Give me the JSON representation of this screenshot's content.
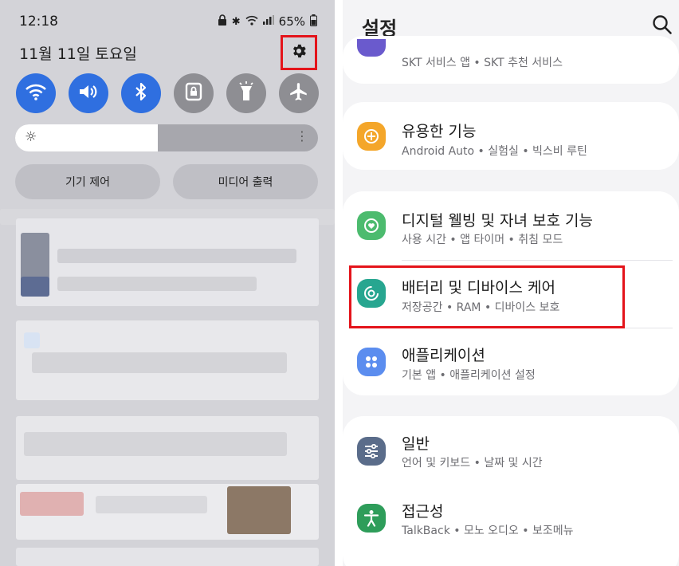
{
  "quick_panel": {
    "status": {
      "time": "12:18",
      "battery": "65%"
    },
    "date": "11월 11일 토요일",
    "settings_icon": "gear-icon",
    "tiles": [
      {
        "name": "wifi",
        "icon": "wifi-icon",
        "state": "on"
      },
      {
        "name": "sound",
        "icon": "volume-icon",
        "state": "on"
      },
      {
        "name": "bluetooth",
        "icon": "bluetooth-icon",
        "state": "on"
      },
      {
        "name": "lock-screen",
        "icon": "lock-icon",
        "state": "off"
      },
      {
        "name": "flashlight",
        "icon": "flashlight-icon",
        "state": "off"
      },
      {
        "name": "airplane",
        "icon": "airplane-icon",
        "state": "off"
      }
    ],
    "brightness_level": 0.47,
    "device_control_label": "기기 제어",
    "media_output_label": "미디어 출력"
  },
  "settings": {
    "title": "설정",
    "search_icon": "search-icon",
    "items": [
      {
        "title": "",
        "subtitle": "SKT 서비스 앱 • SKT 추천 서비스",
        "icon": "skt-icon",
        "color": "#6a5acd"
      },
      {
        "title": "유용한 기능",
        "subtitle": "Android Auto • 실험실 • 빅스비 루틴",
        "icon": "plus-icon",
        "color": "#f4a62a"
      },
      {
        "title": "디지털 웰빙 및 자녀 보호 기능",
        "subtitle": "사용 시간 • 앱 타이머 • 취침 모드",
        "icon": "heart-icon",
        "color": "#4cbb6e"
      },
      {
        "title": "배터리 및 디바이스 케어",
        "subtitle": "저장공간 • RAM • 디바이스 보호",
        "icon": "device-care-icon",
        "color": "#27a690"
      },
      {
        "title": "애플리케이션",
        "subtitle": "기본 앱 • 애플리케이션 설정",
        "icon": "apps-icon",
        "color": "#5b8def"
      },
      {
        "title": "일반",
        "subtitle": "언어 및 키보드 • 날짜 및 시간",
        "icon": "sliders-icon",
        "color": "#5a6c8a"
      },
      {
        "title": "접근성",
        "subtitle": "TalkBack • 모노 오디오 • 보조메뉴",
        "icon": "accessibility-icon",
        "color": "#2e9d5a"
      }
    ]
  },
  "colors": {
    "highlight": "#e4141b",
    "tile_on": "#2f6fe0",
    "tile_off": "#8e8e93"
  }
}
